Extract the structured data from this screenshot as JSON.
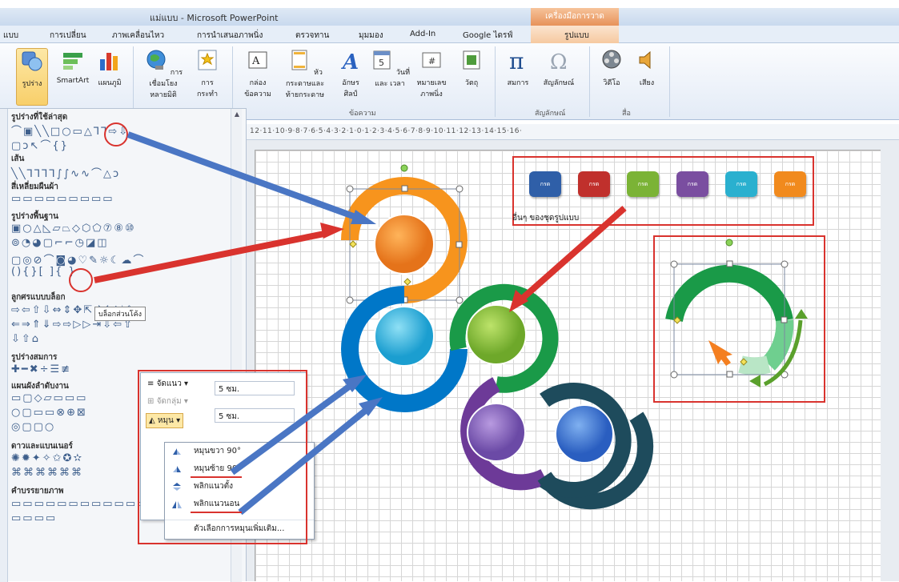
{
  "window": {
    "title": "แม่แบบ - Microsoft PowerPoint",
    "contextual_tab_group": "เครื่องมือการวาด"
  },
  "ribbon_tabs": [
    "แบบ",
    "การเปลี่ยน",
    "ภาพเคลื่อนไหว",
    "การนำเสนอภาพนิ่ง",
    "ตรวจทาน",
    "มุมมอง",
    "Add-In",
    "Google ไดรฟ์",
    "รูปแบบ"
  ],
  "ribbon_buttons": [
    {
      "label": "รูปร่าง",
      "icon": "shapes-icon"
    },
    {
      "label": "SmartArt",
      "icon": "smartart-icon"
    },
    {
      "label": "แผนภูมิ",
      "icon": "chart-icon"
    },
    {
      "label": "การเชื่อมโยง หลายมิติ",
      "icon": "hyperlink-globe-icon"
    },
    {
      "label": "การ กระทำ",
      "icon": "action-star-icon"
    },
    {
      "label": "กล่อง ข้อความ",
      "icon": "textbox-icon"
    },
    {
      "label": "หัวกระดาษและ ท้ายกระดาษ",
      "icon": "header-footer-icon"
    },
    {
      "label": "อักษร ศิลป์",
      "icon": "wordart-icon"
    },
    {
      "label": "วันที่และ เวลา",
      "icon": "date-time-icon"
    },
    {
      "label": "หมายเลข ภาพนิ่ง",
      "icon": "slide-number-icon"
    },
    {
      "label": "วัตถุ",
      "icon": "object-icon"
    },
    {
      "label": "สมการ",
      "icon": "equation-pi-icon"
    },
    {
      "label": "สัญลักษณ์",
      "icon": "omega-symbol-icon"
    },
    {
      "label": "วิดีโอ",
      "icon": "video-reel-icon"
    },
    {
      "label": "เสียง",
      "icon": "speaker-icon"
    }
  ],
  "ribbon_groups": [
    "ข้อความ",
    "สัญลักษณ์",
    "สื่อ"
  ],
  "shapes_panel": {
    "categories": [
      {
        "title": "รูปร่างที่ใช้ล่าสุด",
        "rows": [
          "⌒▣╲╲□○▭△⅂⅂⇨⇩",
          "▢ↄ↖⌒{}"
        ]
      },
      {
        "title": "เส้น",
        "rows": [
          "╲╲⅂⅂⅂⅂∫∫∿∿⌒△ↄ"
        ]
      },
      {
        "title": "สี่เหลี่ยมผืนผ้า",
        "rows": [
          "▭▭▭▭▭▭▭▭▭"
        ]
      },
      {
        "title": "รูปร่างพื้นฐาน",
        "rows": [
          "▣○△◺▱⏢◇⬡⬠⑦⑧⑩",
          "⊚◔◕▢⌐⌐◷◪◫",
          "▢◎⊘⌒◙◕♡✎☼☾☁⌒",
          "(){}[ ]{ }"
        ]
      },
      {
        "title": "ลูกศรแบบบล็อก",
        "rows": [
          "⇨⇦⇧⇩⇔⇕✥⇱↱↰⇲⇳",
          "⇐⇒⇑⇓⇨⇨▷▷⇥⇩⇦⇧",
          "⇩⇧⌂"
        ]
      },
      {
        "title": "รูปร่างสมการ",
        "rows": [
          "✚━✖÷☰≢"
        ]
      },
      {
        "title": "แผนผังลำดับงาน",
        "rows": [
          "▭▢◇▱▭▭▭",
          "○▢▭▭⊗⊕⊠",
          "◎▢▢○"
        ]
      },
      {
        "title": "ดาวและแบนเนอร์",
        "rows": [
          "✺✹✦✧✩✪✫",
          "⌘⌘⌘⌘⌘⌘"
        ]
      },
      {
        "title": "คำบรรยายภาพ",
        "rows": [
          "▭▭▭▭▭▭▭▭▭▭▭▭",
          "▭▭▭▭"
        ]
      }
    ],
    "tooltip": "บล็อกส่วนโค้ง"
  },
  "ruler_text": "12·11·10·9·8·7·6·5·4·3·2·1·0·1·2·3·4·5·6·7·8·9·10·11·12·13·14·15·16·",
  "arrange_panel": {
    "align": "จัดแนว",
    "group": "จัดกลุ่ม",
    "rotate": "หมุน",
    "height_value": "5 ซม.",
    "width_value": "5 ซม."
  },
  "rotate_menu": [
    {
      "label": "หมุนขวา 90°",
      "icon": "rotate-right-icon"
    },
    {
      "label": "หมุนซ้าย 90°",
      "icon": "rotate-left-icon"
    },
    {
      "label": "พลิกแนวตั้ง",
      "icon": "flip-vertical-icon"
    },
    {
      "label": "พลิกแนวนอน",
      "icon": "flip-horizontal-icon"
    },
    {
      "label": "ตัวเลือกการหมุนเพิ่มเติม..."
    }
  ],
  "style_swatches": {
    "label": "กรด",
    "colors": [
      "#2f5fa8",
      "#c0302c",
      "#7bb336",
      "#7a4ea0",
      "#2ab0cf",
      "#f18a1d"
    ],
    "caption": "อื่นๆ ของชุดรูปแบบ"
  },
  "colors": {
    "orange": "#f7941d",
    "blue": "#0077c8",
    "green": "#1a9a48",
    "purple": "#6d3a98",
    "dark_teal": "#1e4b5c",
    "annotation_red": "#d9332e",
    "annotation_blue": "#4a76c4"
  }
}
